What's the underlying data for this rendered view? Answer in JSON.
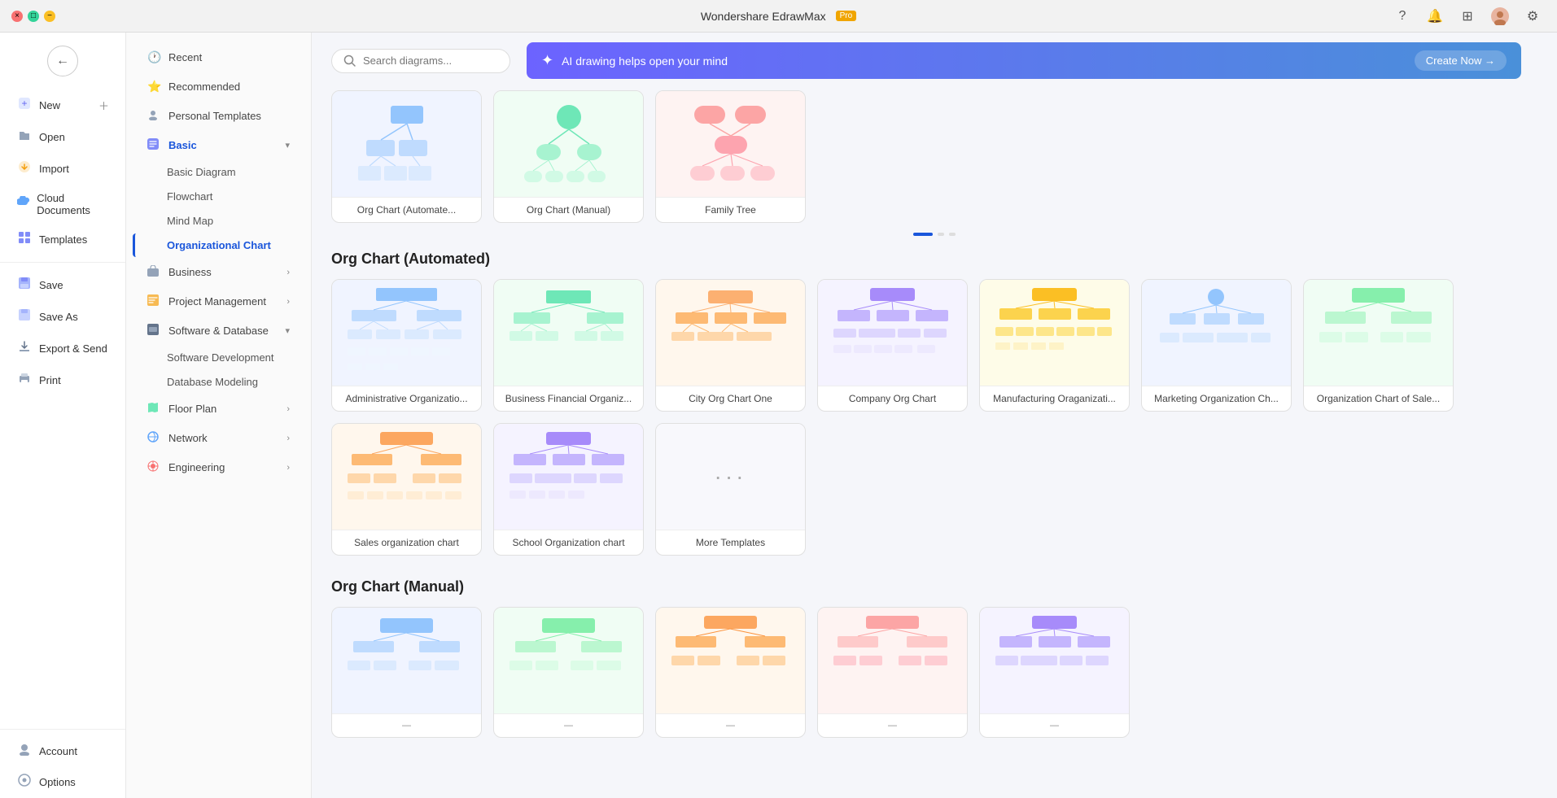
{
  "app": {
    "title": "Wondershare EdrawMax",
    "pro_badge": "Pro"
  },
  "window_controls": {
    "minimize": "−",
    "maximize": "□",
    "close": "×"
  },
  "sidebar": {
    "back_label": "←",
    "items": [
      {
        "id": "new",
        "label": "New",
        "icon": "＋",
        "has_plus": true
      },
      {
        "id": "open",
        "label": "Open",
        "icon": "📂"
      },
      {
        "id": "import",
        "label": "Import",
        "icon": "⬇"
      },
      {
        "id": "cloud",
        "label": "Cloud Documents",
        "icon": "☁"
      },
      {
        "id": "templates",
        "label": "Templates",
        "icon": "▦"
      },
      {
        "id": "save",
        "label": "Save",
        "icon": "💾"
      },
      {
        "id": "save-as",
        "label": "Save As",
        "icon": "💾"
      },
      {
        "id": "export",
        "label": "Export & Send",
        "icon": "📤"
      },
      {
        "id": "print",
        "label": "Print",
        "icon": "🖨"
      }
    ],
    "bottom_items": [
      {
        "id": "account",
        "label": "Account",
        "icon": "👤"
      },
      {
        "id": "options",
        "label": "Options",
        "icon": "⚙"
      }
    ]
  },
  "panel": {
    "items": [
      {
        "id": "recent",
        "label": "Recent",
        "icon": "🕐"
      },
      {
        "id": "recommended",
        "label": "Recommended",
        "icon": "★"
      },
      {
        "id": "personal",
        "label": "Personal Templates",
        "icon": "👤"
      }
    ],
    "categories": [
      {
        "id": "basic",
        "label": "Basic",
        "icon": "🔷",
        "expanded": true,
        "subs": [
          {
            "id": "basic-diagram",
            "label": "Basic Diagram"
          },
          {
            "id": "flowchart",
            "label": "Flowchart"
          },
          {
            "id": "mind-map",
            "label": "Mind Map"
          },
          {
            "id": "org-chart",
            "label": "Organizational Chart",
            "active": true
          }
        ]
      },
      {
        "id": "business",
        "label": "Business",
        "icon": "💼",
        "expanded": false,
        "subs": []
      },
      {
        "id": "project",
        "label": "Project Management",
        "icon": "📋",
        "expanded": false,
        "subs": []
      },
      {
        "id": "software",
        "label": "Software & Database",
        "icon": "🖥",
        "expanded": true,
        "subs": [
          {
            "id": "sw-dev",
            "label": "Software Development"
          },
          {
            "id": "db-model",
            "label": "Database Modeling"
          }
        ]
      },
      {
        "id": "floor",
        "label": "Floor Plan",
        "icon": "🏠",
        "expanded": false,
        "subs": []
      },
      {
        "id": "network",
        "label": "Network",
        "icon": "🌐",
        "expanded": false,
        "subs": []
      },
      {
        "id": "engineering",
        "label": "Engineering",
        "icon": "⚙",
        "expanded": false,
        "subs": []
      }
    ]
  },
  "search": {
    "placeholder": "Search diagrams..."
  },
  "ai_banner": {
    "icon": "✦",
    "text": "AI drawing helps open your mind",
    "cta": "Create Now →"
  },
  "top_icons": [
    {
      "id": "help",
      "icon": "?"
    },
    {
      "id": "notifications",
      "icon": "🔔"
    },
    {
      "id": "layout",
      "icon": "⊞"
    },
    {
      "id": "user",
      "icon": "👤"
    },
    {
      "id": "settings",
      "icon": "⚙"
    }
  ],
  "featured_section": {
    "cards": [
      {
        "id": "org-auto",
        "label": "Org Chart (Automate..."
      },
      {
        "id": "org-manual",
        "label": "Org Chart (Manual)"
      },
      {
        "id": "family-tree",
        "label": "Family Tree"
      }
    ]
  },
  "org_automated": {
    "title": "Org Chart (Automated)",
    "cards": [
      {
        "id": "admin-org",
        "label": "Administrative Organizatio..."
      },
      {
        "id": "biz-fin-org",
        "label": "Business Financial Organiz..."
      },
      {
        "id": "city-org",
        "label": "City Org Chart One"
      },
      {
        "id": "company-org",
        "label": "Company Org Chart"
      },
      {
        "id": "manufacturing-org",
        "label": "Manufacturing Oraganizati..."
      },
      {
        "id": "marketing-org",
        "label": "Marketing Organization Ch..."
      },
      {
        "id": "sale-org",
        "label": "Organization Chart of Sale..."
      },
      {
        "id": "sales-org",
        "label": "Sales organization chart"
      },
      {
        "id": "school-org",
        "label": "School Organization chart"
      },
      {
        "id": "more",
        "label": "More Templates",
        "is_more": true
      }
    ]
  },
  "org_manual": {
    "title": "Org Chart (Manual)",
    "cards": [
      {
        "id": "manual-1",
        "label": ""
      },
      {
        "id": "manual-2",
        "label": ""
      },
      {
        "id": "manual-3",
        "label": ""
      },
      {
        "id": "manual-4",
        "label": ""
      },
      {
        "id": "manual-5",
        "label": ""
      }
    ]
  },
  "colors": {
    "accent_blue": "#1a56db",
    "ai_gradient_start": "#6c63ff",
    "ai_gradient_end": "#4a90d9",
    "card_bg": "#ffffff",
    "thumb_bg": "#eef2ff"
  }
}
